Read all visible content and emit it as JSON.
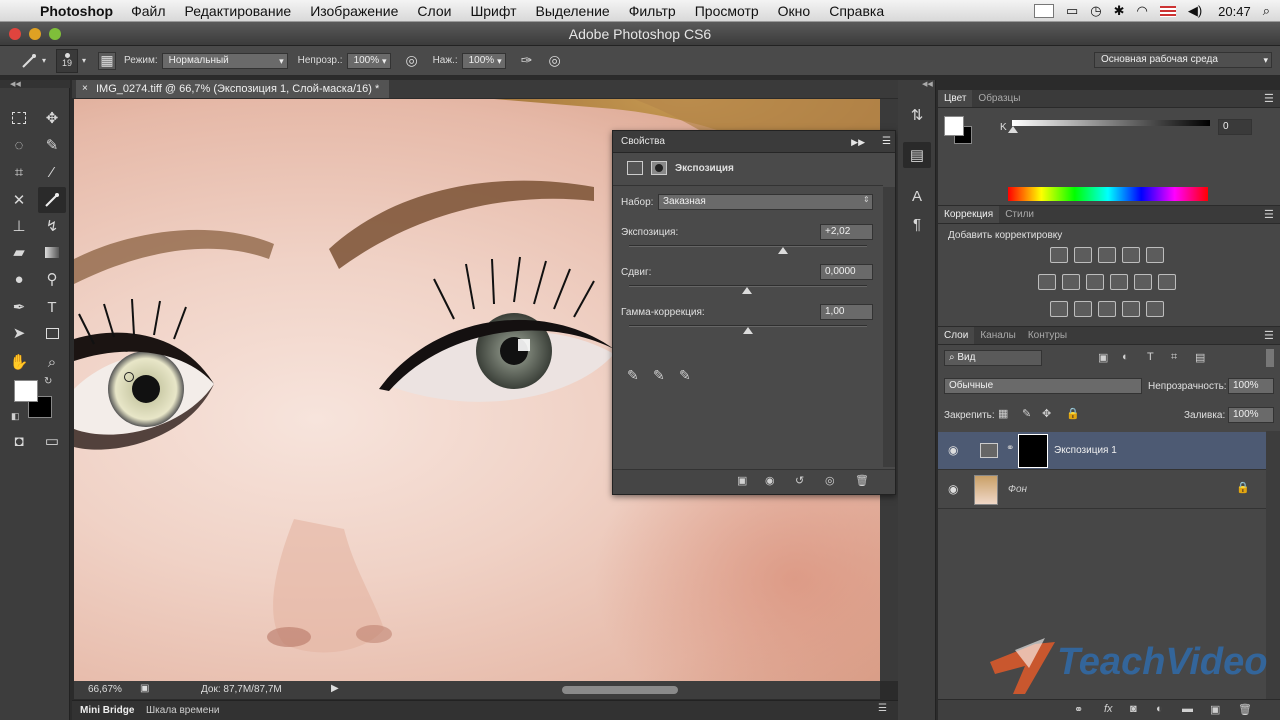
{
  "menubar": {
    "apple_icon": "apple-icon",
    "app_name": "Photoshop",
    "items": [
      "Файл",
      "Редактирование",
      "Изображение",
      "Слои",
      "Шрифт",
      "Выделение",
      "Фильтр",
      "Просмотр",
      "Окно",
      "Справка"
    ],
    "clock": "20:47"
  },
  "window": {
    "title": "Adobe Photoshop CS6"
  },
  "options": {
    "brush_size": "19",
    "mode_label": "Режим:",
    "mode_value": "Нормальный",
    "opacity_label": "Непрозр.:",
    "opacity_value": "100%",
    "flow_label": "Наж.:",
    "flow_value": "100%",
    "workspace": "Основная рабочая среда"
  },
  "document": {
    "tab_title": "IMG_0274.tiff @ 66,7% (Экспозиция 1, Слой-маска/16) *",
    "zoom": "66,67%",
    "doc_info": "Док: 87,7M/87,7M"
  },
  "bottom_tabs": [
    "Mini Bridge",
    "Шкала времени"
  ],
  "properties": {
    "title": "Свойства",
    "adjustment_name": "Экспозиция",
    "preset_label": "Набор:",
    "preset_value": "Заказная",
    "exposure_label": "Экспозиция:",
    "exposure_value": "+2,02",
    "offset_label": "Сдвиг:",
    "offset_value": "0,0000",
    "gamma_label": "Гамма-коррекция:",
    "gamma_value": "1,00"
  },
  "color_panel": {
    "tabs": [
      "Цвет",
      "Образцы"
    ],
    "channel_label": "K",
    "channel_value": "0"
  },
  "adjustments_panel": {
    "tabs": [
      "Коррекция",
      "Стили"
    ],
    "heading": "Добавить корректировку"
  },
  "layers_panel": {
    "tabs": [
      "Слои",
      "Каналы",
      "Контуры"
    ],
    "filter_label": "Вид",
    "blend_mode": "Обычные",
    "opacity_label": "Непрозрачность:",
    "opacity_value": "100%",
    "lock_label": "Закрепить:",
    "fill_label": "Заливка:",
    "fill_value": "100%",
    "layers": [
      {
        "name": "Экспозиция 1",
        "selected": true
      },
      {
        "name": "Фон",
        "selected": false
      }
    ]
  },
  "watermark": "TeachVideo",
  "colors": {
    "accent": "#4d5a73",
    "canvas_skin": "#f0d2c6",
    "panel": "#474747"
  }
}
